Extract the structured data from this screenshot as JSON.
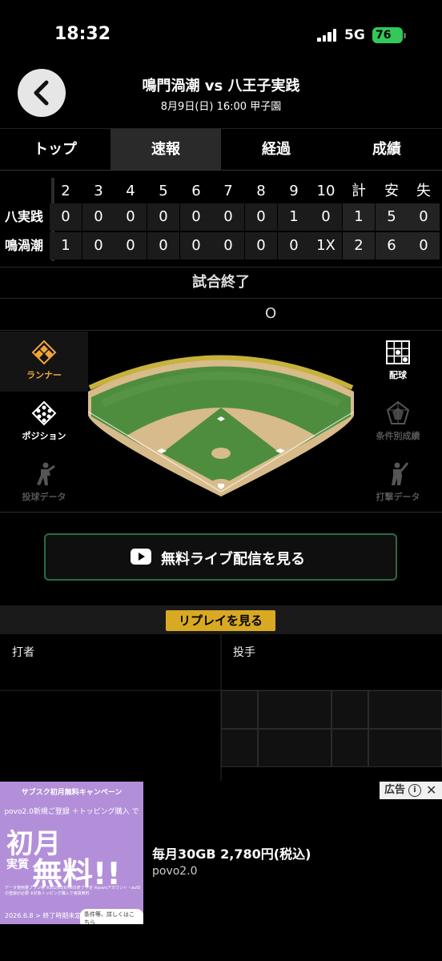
{
  "status": {
    "time": "18:32",
    "network": "5G",
    "battery": "76"
  },
  "header": {
    "title": "鳴門渦潮 vs 八王子実践",
    "subtitle": "8月9日(日) 16:00 甲子園"
  },
  "tabs": [
    "トップ",
    "速報",
    "経過",
    "成績"
  ],
  "scoreboard": {
    "columns": [
      "2",
      "3",
      "4",
      "5",
      "6",
      "7",
      "8",
      "9",
      "10",
      "計",
      "安",
      "失"
    ],
    "rows": [
      {
        "team": "八実践",
        "cells": [
          "0",
          "0",
          "0",
          "0",
          "0",
          "0",
          "0",
          "1",
          "0",
          "1",
          "5",
          "0"
        ]
      },
      {
        "team": "鳴渦潮",
        "cells": [
          "1",
          "0",
          "0",
          "0",
          "0",
          "0",
          "0",
          "0",
          "1X",
          "2",
          "6",
          "0"
        ]
      }
    ]
  },
  "game_status": "試合終了",
  "count_display": "O",
  "left_menu": [
    "ランナー",
    "ポジション",
    "投球データ"
  ],
  "right_menu": [
    "配球",
    "条件別成績",
    "打撃データ"
  ],
  "live_button": "無料ライブ配信を見る",
  "replay_button": "リプレイを見る",
  "batter_label": "打者",
  "pitcher_label": "投手",
  "ad": {
    "badge": "広告",
    "campaign": "サブスク初月無料キャンペーン",
    "line2": "povo2.0新規ご登録 ＋トッピング購入 で",
    "big1": "初月",
    "big2": "実質",
    "big3": "無料!!",
    "fineprint": "データ使用量プラン等 ※2026年6月8日終了予定 ※povoアカウント・auIDの登録が必要 ※対象トッピング購入で実質無料",
    "date": "2026.6.8 > 終了時期未定",
    "more": "条件等、詳しくはこちら",
    "title": "毎月30GB 2,780円(税込)",
    "advertiser": "povo2.0"
  }
}
